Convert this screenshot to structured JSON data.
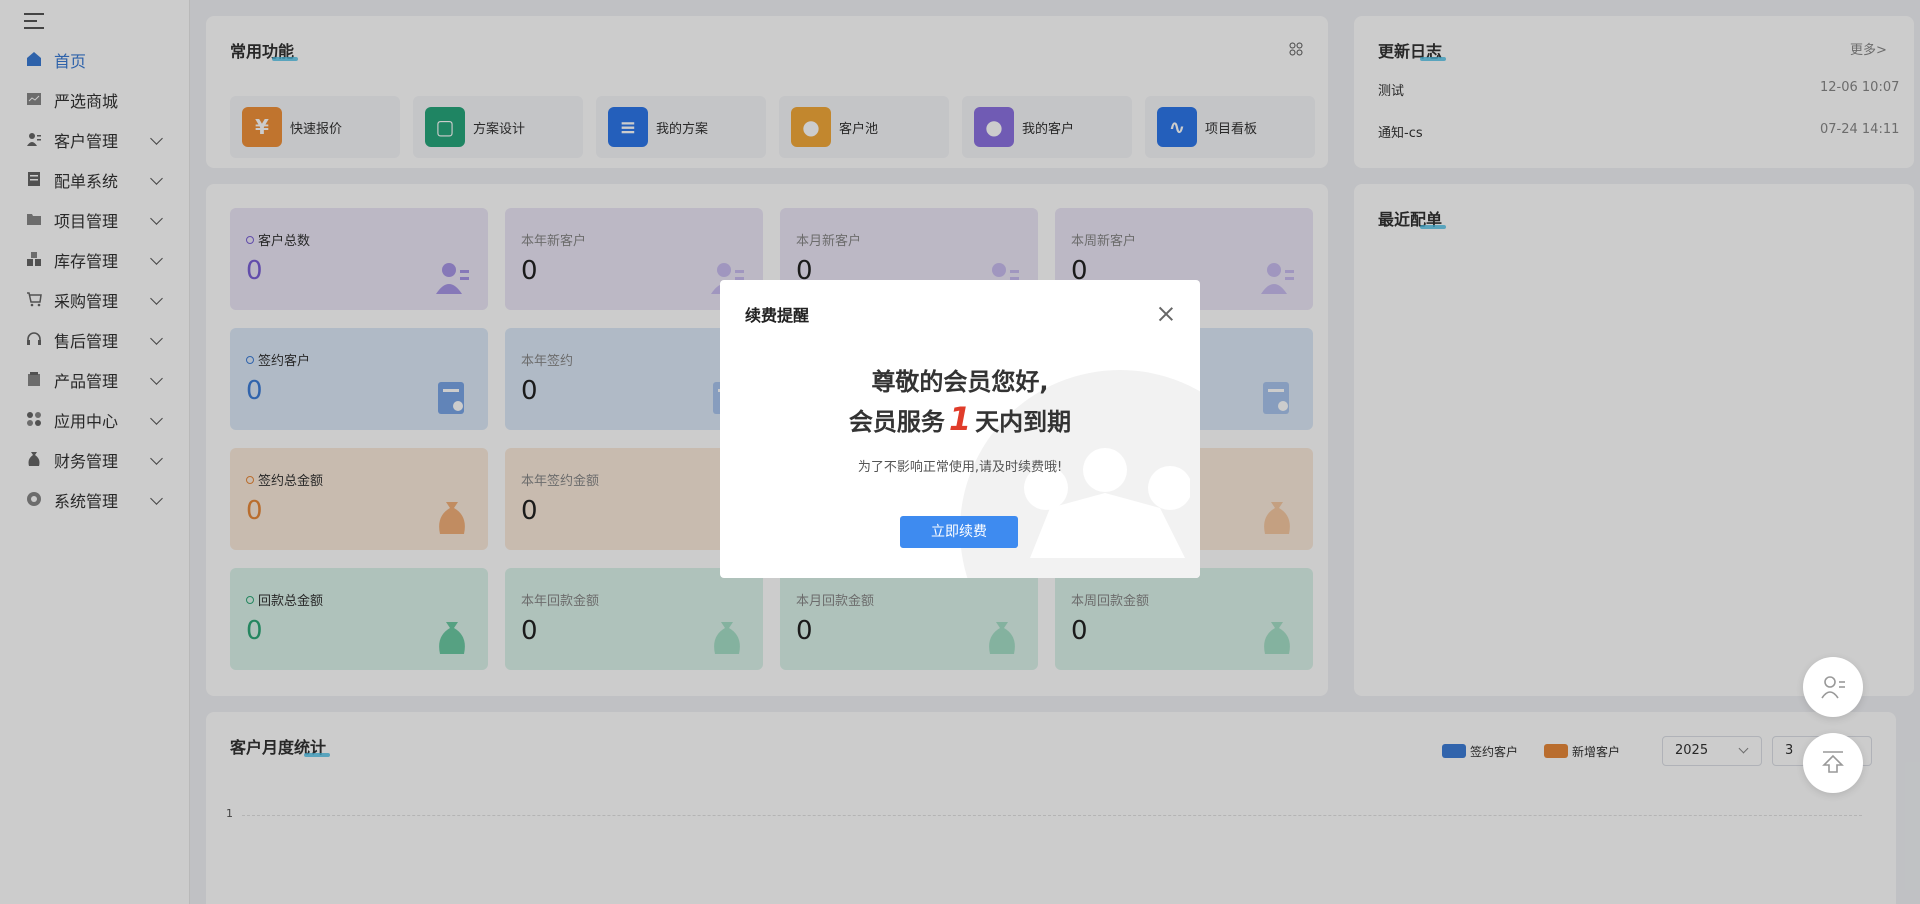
{
  "sidebar": {
    "items": [
      {
        "label": "首页",
        "icon": "home-icon",
        "active": true
      },
      {
        "label": "严选商城",
        "icon": "mall-icon"
      },
      {
        "label": "客户管理",
        "icon": "customer-icon"
      },
      {
        "label": "配单系统",
        "icon": "order-icon"
      },
      {
        "label": "项目管理",
        "icon": "folder-icon"
      },
      {
        "label": "库存管理",
        "icon": "inventory-icon"
      },
      {
        "label": "采购管理",
        "icon": "cart-icon"
      },
      {
        "label": "售后管理",
        "icon": "headset-icon"
      },
      {
        "label": "产品管理",
        "icon": "product-icon"
      },
      {
        "label": "应用中心",
        "icon": "apps-icon"
      },
      {
        "label": "财务管理",
        "icon": "finance-icon"
      },
      {
        "label": "系统管理",
        "icon": "settings-icon"
      }
    ]
  },
  "common": {
    "title": "常用功能",
    "items": [
      {
        "label": "快速报价",
        "glyph": "¥",
        "color": "#f0923a"
      },
      {
        "label": "方案设计",
        "glyph": "▢",
        "color": "#27a77c"
      },
      {
        "label": "我的方案",
        "glyph": "≡",
        "color": "#2d77ea"
      },
      {
        "label": "客户池",
        "glyph": "●",
        "color": "#f3a93a"
      },
      {
        "label": "我的客户",
        "glyph": "●",
        "color": "#8d72e1"
      },
      {
        "label": "项目看板",
        "glyph": "∿",
        "color": "#2d77ea"
      }
    ]
  },
  "changelog": {
    "title": "更新日志",
    "more": "更多>",
    "items": [
      {
        "label": "测试",
        "time": "12-06 10:07"
      },
      {
        "label": "通知-cs",
        "time": "07-24 14:11"
      }
    ]
  },
  "stats": [
    {
      "label": "客户总数",
      "value": "0",
      "color": "#7b61d6",
      "theme": "purple"
    },
    {
      "label": "本年新客户",
      "value": "0",
      "theme": "purple"
    },
    {
      "label": "本月新客户",
      "value": "0",
      "theme": "purple"
    },
    {
      "label": "本周新客户",
      "value": "0",
      "theme": "purple"
    },
    {
      "label": "签约客户",
      "value": "0",
      "color": "#3e7ed8",
      "theme": "blue"
    },
    {
      "label": "本年签约",
      "value": "0",
      "theme": "blue"
    },
    {
      "label": "签约总金额",
      "value": "0",
      "color": "#e8893a",
      "theme": "orange"
    },
    {
      "label": "本年签约金额",
      "value": "0",
      "theme": "orange"
    },
    {
      "label": "回款总金额",
      "value": "0",
      "color": "#2fa878",
      "theme": "green"
    },
    {
      "label": "本年回款金额",
      "value": "0",
      "theme": "green"
    },
    {
      "label": "本月回款金额",
      "value": "0",
      "theme": "green"
    },
    {
      "label": "本周回款金额",
      "value": "0",
      "theme": "green"
    }
  ],
  "recent_orders": {
    "title": "最近配单"
  },
  "monthly": {
    "title": "客户月度统计",
    "legend": [
      {
        "name": "签约客户",
        "color": "#3e7ed8"
      },
      {
        "name": "新增客户",
        "color": "#e8893a"
      }
    ],
    "year": "2025",
    "month": "3",
    "y_tick": "1"
  },
  "modal": {
    "title": "续费提醒",
    "line1": "尊敬的会员您好,",
    "line2_pre": "会员服务",
    "line2_num": "1",
    "line2_post": "天内到期",
    "desc": "为了不影响正常使用,请及时续费哦!",
    "button": "立即续费"
  },
  "colors": {
    "accent": "#3e8bf0",
    "warning": "#e03c2a"
  }
}
